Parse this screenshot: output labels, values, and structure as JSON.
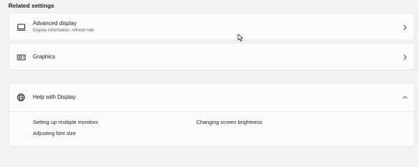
{
  "section": {
    "title": "Related settings"
  },
  "advanced_display": {
    "title": "Advanced display",
    "subtitle": "Display information, refresh rate",
    "icon": "monitor-icon"
  },
  "graphics": {
    "title": "Graphics",
    "icon": "graphics-card-icon"
  },
  "help": {
    "title": "Help with Display",
    "icon": "globe-icon",
    "expanded": true,
    "links": [
      "Setting up multiple monitors",
      "Changing screen brightness",
      "Adjusting font size"
    ]
  },
  "colors": {
    "background": "#f3f3f3",
    "card": "#fbfbfb",
    "border": "#e6e6e6",
    "text": "#1b1b1b",
    "subtext": "#5d5d5d"
  }
}
